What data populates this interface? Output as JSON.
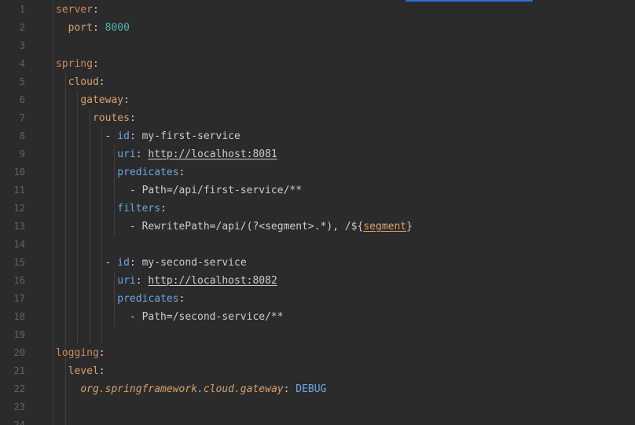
{
  "editor": {
    "lines": [
      {
        "n": "1",
        "tokens": [
          {
            "c": "k1",
            "t": "server"
          },
          {
            "c": "punct",
            "t": ":"
          }
        ]
      },
      {
        "n": "2",
        "tokens": [
          {
            "c": "plain",
            "t": "  "
          },
          {
            "c": "k2",
            "t": "port"
          },
          {
            "c": "punct",
            "t": ": "
          },
          {
            "c": "num",
            "t": "8000"
          }
        ]
      },
      {
        "n": "3",
        "tokens": []
      },
      {
        "n": "4",
        "tokens": [
          {
            "c": "k1",
            "t": "spring"
          },
          {
            "c": "punct",
            "t": ":"
          }
        ]
      },
      {
        "n": "5",
        "tokens": [
          {
            "c": "plain",
            "t": "  "
          },
          {
            "c": "k2",
            "t": "cloud"
          },
          {
            "c": "punct",
            "t": ":"
          }
        ]
      },
      {
        "n": "6",
        "tokens": [
          {
            "c": "plain",
            "t": "    "
          },
          {
            "c": "k2",
            "t": "gateway"
          },
          {
            "c": "punct",
            "t": ":"
          }
        ]
      },
      {
        "n": "7",
        "tokens": [
          {
            "c": "plain",
            "t": "      "
          },
          {
            "c": "k2",
            "t": "routes"
          },
          {
            "c": "punct",
            "t": ":"
          }
        ]
      },
      {
        "n": "8",
        "tokens": [
          {
            "c": "plain",
            "t": "        - "
          },
          {
            "c": "k3",
            "t": "id"
          },
          {
            "c": "punct",
            "t": ": "
          },
          {
            "c": "plain",
            "t": "my-first-service"
          }
        ]
      },
      {
        "n": "9",
        "tokens": [
          {
            "c": "plain",
            "t": "          "
          },
          {
            "c": "k3",
            "t": "uri"
          },
          {
            "c": "punct",
            "t": ": "
          },
          {
            "c": "link",
            "t": "http://localhost:8081"
          }
        ]
      },
      {
        "n": "10",
        "tokens": [
          {
            "c": "plain",
            "t": "          "
          },
          {
            "c": "k3",
            "t": "predicates"
          },
          {
            "c": "punct",
            "t": ":"
          }
        ]
      },
      {
        "n": "11",
        "tokens": [
          {
            "c": "plain",
            "t": "            - Path=/api/first-service/**"
          }
        ]
      },
      {
        "n": "12",
        "tokens": [
          {
            "c": "plain",
            "t": "          "
          },
          {
            "c": "k3",
            "t": "filters"
          },
          {
            "c": "punct",
            "t": ":"
          }
        ]
      },
      {
        "n": "13",
        "tokens": [
          {
            "c": "plain",
            "t": "            - RewritePath=/api/(?<segment>.*), /${"
          },
          {
            "c": "seg",
            "t": "segment"
          },
          {
            "c": "plain",
            "t": "}"
          }
        ]
      },
      {
        "n": "14",
        "tokens": []
      },
      {
        "n": "15",
        "tokens": [
          {
            "c": "plain",
            "t": "        - "
          },
          {
            "c": "k3",
            "t": "id"
          },
          {
            "c": "punct",
            "t": ": "
          },
          {
            "c": "plain",
            "t": "my-second-service"
          }
        ]
      },
      {
        "n": "16",
        "tokens": [
          {
            "c": "plain",
            "t": "          "
          },
          {
            "c": "k3",
            "t": "uri"
          },
          {
            "c": "punct",
            "t": ": "
          },
          {
            "c": "link",
            "t": "http://localhost:8082"
          }
        ]
      },
      {
        "n": "17",
        "tokens": [
          {
            "c": "plain",
            "t": "          "
          },
          {
            "c": "k3",
            "t": "predicates"
          },
          {
            "c": "punct",
            "t": ":"
          }
        ]
      },
      {
        "n": "18",
        "tokens": [
          {
            "c": "plain",
            "t": "            - Path=/second-service/**"
          }
        ]
      },
      {
        "n": "19",
        "tokens": []
      },
      {
        "n": "20",
        "tokens": [
          {
            "c": "k1",
            "t": "logging"
          },
          {
            "c": "punct",
            "t": ":"
          }
        ]
      },
      {
        "n": "21",
        "tokens": [
          {
            "c": "plain",
            "t": "  "
          },
          {
            "c": "k2",
            "t": "level"
          },
          {
            "c": "punct",
            "t": ":"
          }
        ]
      },
      {
        "n": "22",
        "tokens": [
          {
            "c": "plain",
            "t": "    "
          },
          {
            "c": "ital",
            "t": "org.springframework.cloud.gateway"
          },
          {
            "c": "punct",
            "t": ": "
          },
          {
            "c": "enum",
            "t": "DEBUG"
          }
        ]
      },
      {
        "n": "23",
        "tokens": []
      },
      {
        "n": "24",
        "tokens": []
      }
    ]
  }
}
